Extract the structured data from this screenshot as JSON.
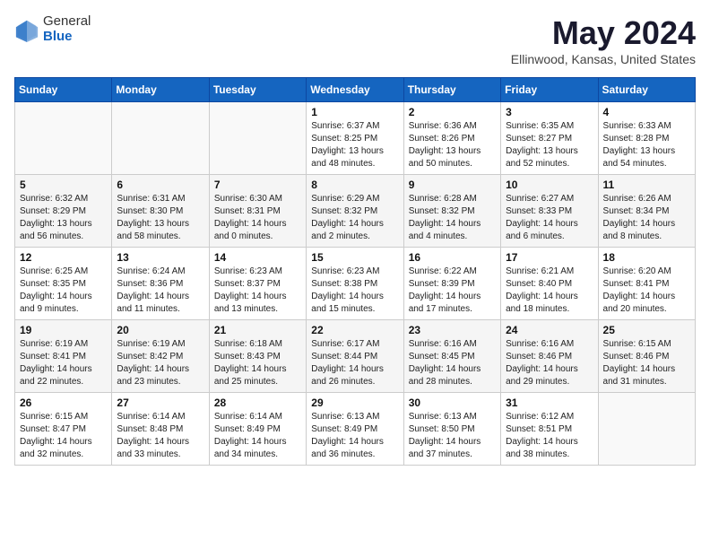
{
  "logo": {
    "general": "General",
    "blue": "Blue"
  },
  "title": "May 2024",
  "subtitle": "Ellinwood, Kansas, United States",
  "days_header": [
    "Sunday",
    "Monday",
    "Tuesday",
    "Wednesday",
    "Thursday",
    "Friday",
    "Saturday"
  ],
  "weeks": [
    [
      {
        "num": "",
        "info": ""
      },
      {
        "num": "",
        "info": ""
      },
      {
        "num": "",
        "info": ""
      },
      {
        "num": "1",
        "info": "Sunrise: 6:37 AM\nSunset: 8:25 PM\nDaylight: 13 hours\nand 48 minutes."
      },
      {
        "num": "2",
        "info": "Sunrise: 6:36 AM\nSunset: 8:26 PM\nDaylight: 13 hours\nand 50 minutes."
      },
      {
        "num": "3",
        "info": "Sunrise: 6:35 AM\nSunset: 8:27 PM\nDaylight: 13 hours\nand 52 minutes."
      },
      {
        "num": "4",
        "info": "Sunrise: 6:33 AM\nSunset: 8:28 PM\nDaylight: 13 hours\nand 54 minutes."
      }
    ],
    [
      {
        "num": "5",
        "info": "Sunrise: 6:32 AM\nSunset: 8:29 PM\nDaylight: 13 hours\nand 56 minutes."
      },
      {
        "num": "6",
        "info": "Sunrise: 6:31 AM\nSunset: 8:30 PM\nDaylight: 13 hours\nand 58 minutes."
      },
      {
        "num": "7",
        "info": "Sunrise: 6:30 AM\nSunset: 8:31 PM\nDaylight: 14 hours\nand 0 minutes."
      },
      {
        "num": "8",
        "info": "Sunrise: 6:29 AM\nSunset: 8:32 PM\nDaylight: 14 hours\nand 2 minutes."
      },
      {
        "num": "9",
        "info": "Sunrise: 6:28 AM\nSunset: 8:32 PM\nDaylight: 14 hours\nand 4 minutes."
      },
      {
        "num": "10",
        "info": "Sunrise: 6:27 AM\nSunset: 8:33 PM\nDaylight: 14 hours\nand 6 minutes."
      },
      {
        "num": "11",
        "info": "Sunrise: 6:26 AM\nSunset: 8:34 PM\nDaylight: 14 hours\nand 8 minutes."
      }
    ],
    [
      {
        "num": "12",
        "info": "Sunrise: 6:25 AM\nSunset: 8:35 PM\nDaylight: 14 hours\nand 9 minutes."
      },
      {
        "num": "13",
        "info": "Sunrise: 6:24 AM\nSunset: 8:36 PM\nDaylight: 14 hours\nand 11 minutes."
      },
      {
        "num": "14",
        "info": "Sunrise: 6:23 AM\nSunset: 8:37 PM\nDaylight: 14 hours\nand 13 minutes."
      },
      {
        "num": "15",
        "info": "Sunrise: 6:23 AM\nSunset: 8:38 PM\nDaylight: 14 hours\nand 15 minutes."
      },
      {
        "num": "16",
        "info": "Sunrise: 6:22 AM\nSunset: 8:39 PM\nDaylight: 14 hours\nand 17 minutes."
      },
      {
        "num": "17",
        "info": "Sunrise: 6:21 AM\nSunset: 8:40 PM\nDaylight: 14 hours\nand 18 minutes."
      },
      {
        "num": "18",
        "info": "Sunrise: 6:20 AM\nSunset: 8:41 PM\nDaylight: 14 hours\nand 20 minutes."
      }
    ],
    [
      {
        "num": "19",
        "info": "Sunrise: 6:19 AM\nSunset: 8:41 PM\nDaylight: 14 hours\nand 22 minutes."
      },
      {
        "num": "20",
        "info": "Sunrise: 6:19 AM\nSunset: 8:42 PM\nDaylight: 14 hours\nand 23 minutes."
      },
      {
        "num": "21",
        "info": "Sunrise: 6:18 AM\nSunset: 8:43 PM\nDaylight: 14 hours\nand 25 minutes."
      },
      {
        "num": "22",
        "info": "Sunrise: 6:17 AM\nSunset: 8:44 PM\nDaylight: 14 hours\nand 26 minutes."
      },
      {
        "num": "23",
        "info": "Sunrise: 6:16 AM\nSunset: 8:45 PM\nDaylight: 14 hours\nand 28 minutes."
      },
      {
        "num": "24",
        "info": "Sunrise: 6:16 AM\nSunset: 8:46 PM\nDaylight: 14 hours\nand 29 minutes."
      },
      {
        "num": "25",
        "info": "Sunrise: 6:15 AM\nSunset: 8:46 PM\nDaylight: 14 hours\nand 31 minutes."
      }
    ],
    [
      {
        "num": "26",
        "info": "Sunrise: 6:15 AM\nSunset: 8:47 PM\nDaylight: 14 hours\nand 32 minutes."
      },
      {
        "num": "27",
        "info": "Sunrise: 6:14 AM\nSunset: 8:48 PM\nDaylight: 14 hours\nand 33 minutes."
      },
      {
        "num": "28",
        "info": "Sunrise: 6:14 AM\nSunset: 8:49 PM\nDaylight: 14 hours\nand 34 minutes."
      },
      {
        "num": "29",
        "info": "Sunrise: 6:13 AM\nSunset: 8:49 PM\nDaylight: 14 hours\nand 36 minutes."
      },
      {
        "num": "30",
        "info": "Sunrise: 6:13 AM\nSunset: 8:50 PM\nDaylight: 14 hours\nand 37 minutes."
      },
      {
        "num": "31",
        "info": "Sunrise: 6:12 AM\nSunset: 8:51 PM\nDaylight: 14 hours\nand 38 minutes."
      },
      {
        "num": "",
        "info": ""
      }
    ]
  ]
}
